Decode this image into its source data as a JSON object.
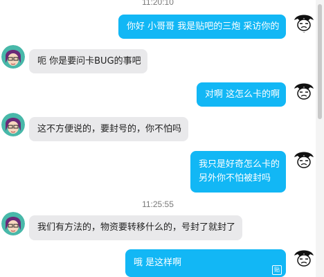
{
  "messages": [
    {
      "kind": "time",
      "text": "11:20:10"
    },
    {
      "kind": "out",
      "lines": [
        "你好 小哥哥 我是贴吧的三炮 采访你的"
      ]
    },
    {
      "kind": "in",
      "lines": [
        "呃 你是要问卡BUG的事吧"
      ]
    },
    {
      "kind": "out",
      "lines": [
        "对啊 这怎么卡的啊"
      ]
    },
    {
      "kind": "in",
      "lines": [
        "这不方便说的，要封号的，你不怕吗"
      ]
    },
    {
      "kind": "out",
      "lines": [
        "我只是好奇怎么卡的",
        "另外你不怕被封吗"
      ]
    },
    {
      "kind": "time",
      "text": "11:25:55"
    },
    {
      "kind": "in",
      "lines": [
        "我们有方法的，物资要转移什么的，号封了就封了"
      ]
    },
    {
      "kind": "out",
      "lines": [
        "哦 是这样啊"
      ]
    }
  ],
  "icons": {
    "paste": "paste-icon",
    "paste_glyph": "贴"
  },
  "colors": {
    "outgoing_bubble": "#12b7f5",
    "incoming_bubble": "#e9e9eb",
    "timestamp": "#777777"
  }
}
